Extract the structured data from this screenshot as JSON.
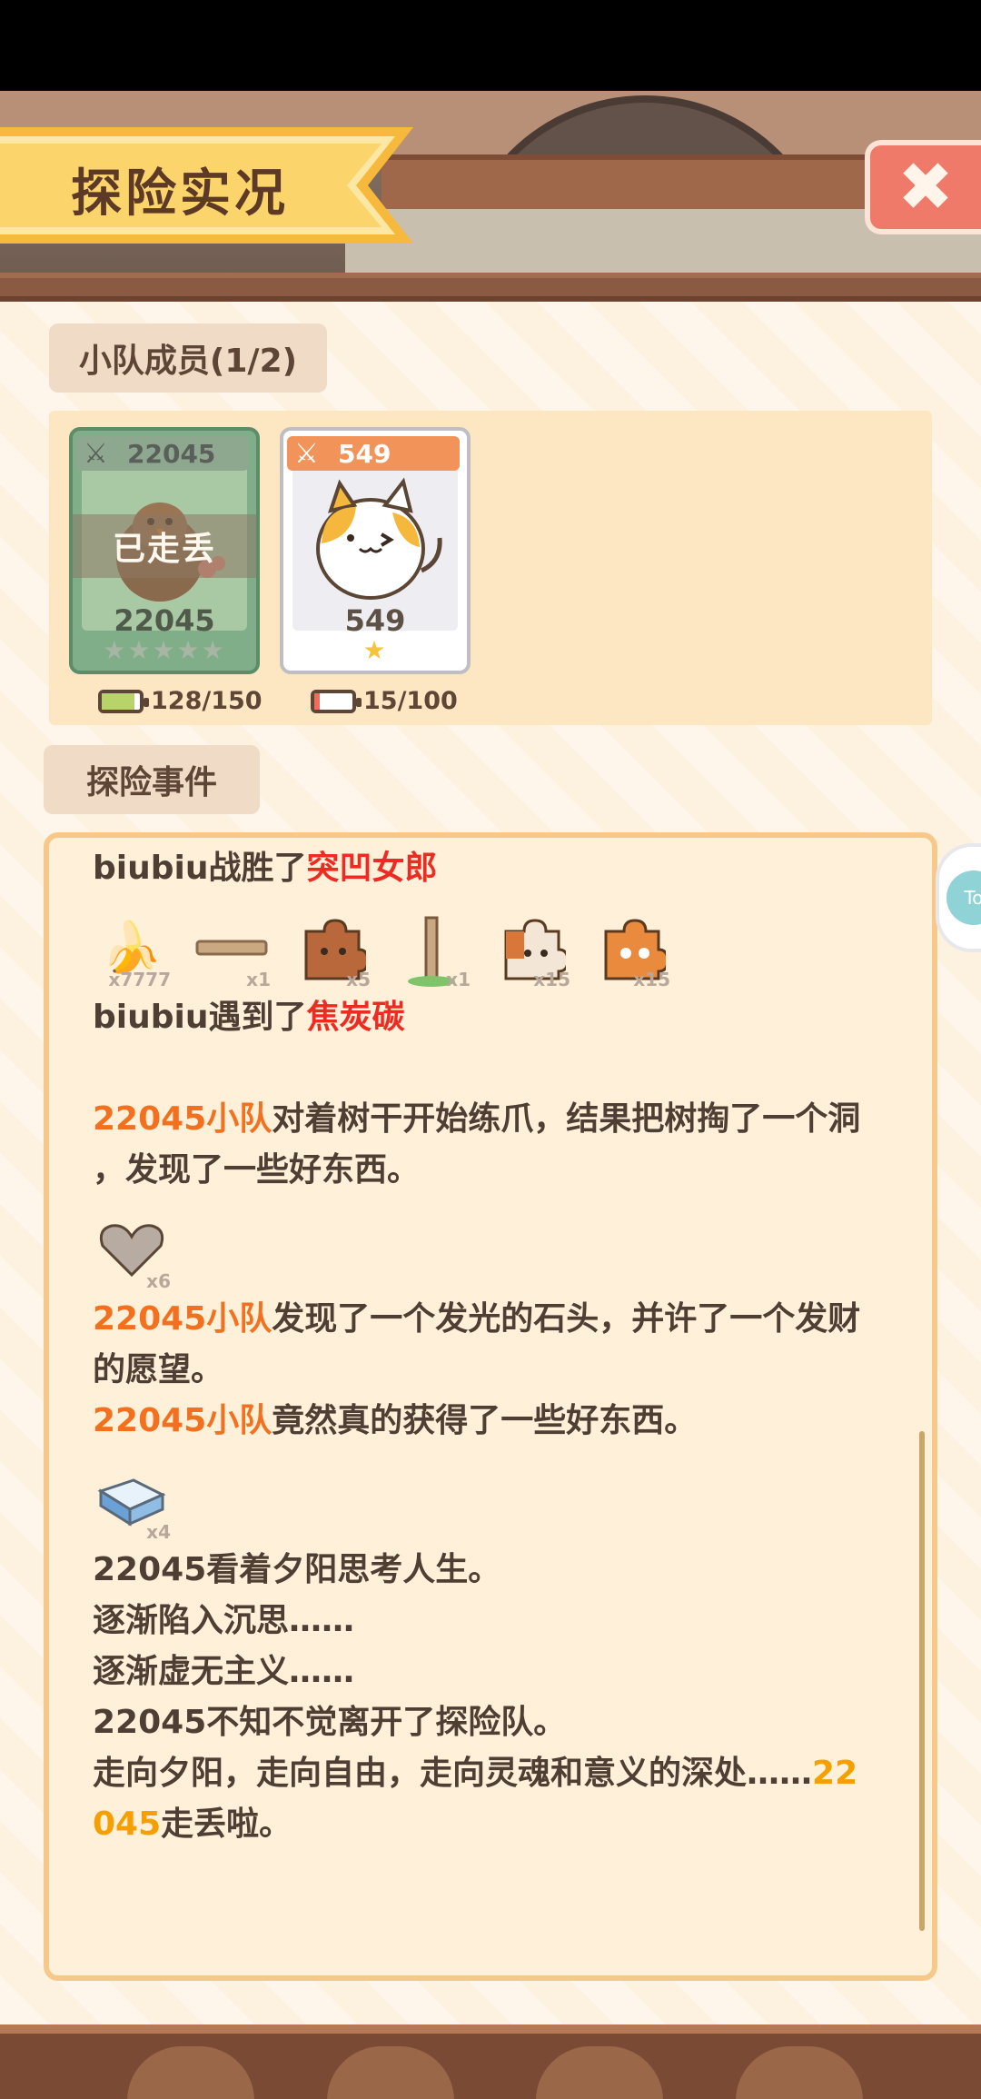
{
  "header": {
    "title": "探险实况",
    "close_icon": "close-x-icon"
  },
  "team": {
    "section_label": "小队成员(1/2)",
    "members": [
      {
        "badge": "22045",
        "name": "22045",
        "status": "已走丢",
        "stars": "★★★★★",
        "stamina": "128/150",
        "stamina_fraction": 0.853
      },
      {
        "badge": "549",
        "name": "549",
        "stars": "★",
        "stamina": "15/100",
        "stamina_fraction": 0.15
      }
    ]
  },
  "events": {
    "section_label": "探险事件",
    "e1_actor": "biubiu",
    "e1_verb": "战胜了",
    "e1_target": "突凹女郎",
    "loot1": [
      {
        "icon": "banana-icon",
        "qty": "x7777"
      },
      {
        "icon": "plank-icon",
        "qty": "x1"
      },
      {
        "icon": "brown-cat-puzzle-icon",
        "qty": "x5"
      },
      {
        "icon": "sapling-icon",
        "qty": "x1"
      },
      {
        "icon": "calico-puzzle-icon",
        "qty": "x15"
      },
      {
        "icon": "orange-puzzle-icon",
        "qty": "x15"
      }
    ],
    "e2_actor": "biubiu",
    "e2_verb": "遇到了",
    "e2_target": "焦炭碳",
    "e3_team": "22045小队",
    "e3_text_a": "对着树干开始练爪，结果把树掏了一个洞",
    "e3_text_b": "，发现了一些好东西。",
    "loot2": [
      {
        "icon": "stone-heart-icon",
        "qty": "x6"
      }
    ],
    "e4_team": "22045小队",
    "e4_text_a": "发现了一个发光的石头，并许了一个发财",
    "e4_text_b": "的愿望。",
    "e5_team": "22045小队",
    "e5_text": "竟然真的获得了一些好东西。",
    "loot3": [
      {
        "icon": "tissue-box-icon",
        "qty": "x4"
      }
    ],
    "e6_l1": "22045看着夕阳思考人生。",
    "e6_l2": "逐渐陷入沉思……",
    "e6_l3": "逐渐虚无主义……",
    "e6_l4": "22045不知不觉离开了探险队。",
    "e6_l5a": "走向夕阳，走向自由，走向灵魂和意义的深处……",
    "e6_l5b": "22",
    "e6_l6a": "045",
    "e6_l6b": "走丢啦。"
  },
  "side": {
    "bubble_label": "To"
  },
  "colors": {
    "panel_bg": "#fdf1e0",
    "event_red": "#ee2b22",
    "event_orange": "#f2701e",
    "event_gold": "#f5a000",
    "close_btn": "#f07a6a"
  }
}
